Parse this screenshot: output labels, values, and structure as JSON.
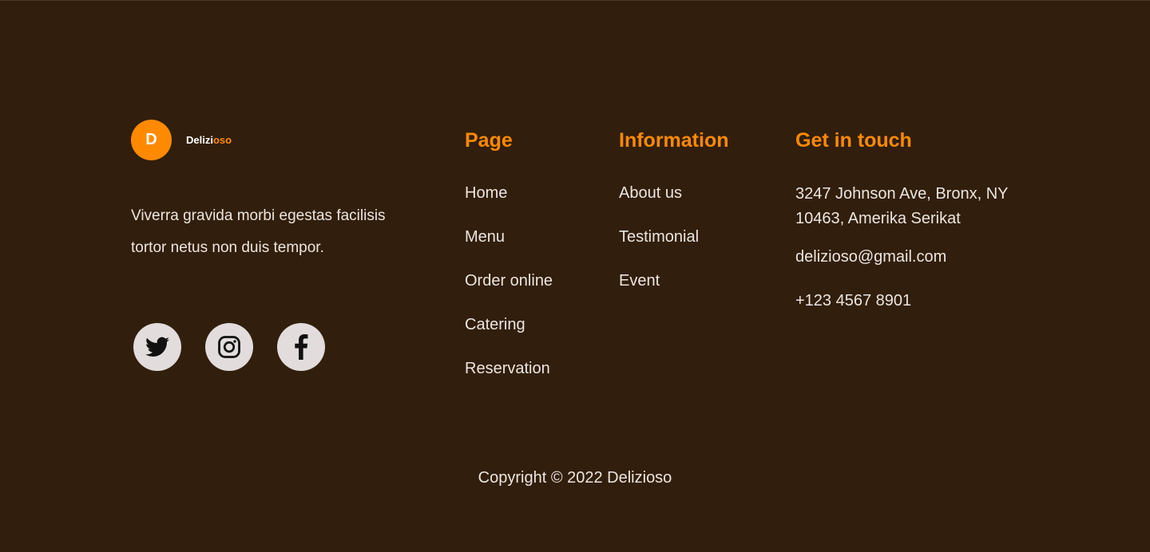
{
  "brand": {
    "logo_letter": "D",
    "name_part1": "Delizi",
    "name_part2": "oso",
    "accent_color": "#ff8a00"
  },
  "tagline": "Viverra gravida morbi egestas facilisis tortor netus non duis tempor.",
  "socials": [
    {
      "icon": "twitter-icon"
    },
    {
      "icon": "instagram-icon"
    },
    {
      "icon": "facebook-icon"
    }
  ],
  "page_column": {
    "title": "Page",
    "links": [
      "Home",
      "Menu",
      "Order online",
      "Catering",
      "Reservation"
    ]
  },
  "info_column": {
    "title": "Information",
    "links": [
      "About us",
      "Testimonial",
      "Event"
    ]
  },
  "contact_column": {
    "title": "Get in touch",
    "address": "3247 Johnson Ave, Bronx, NY 10463, Amerika Serikat",
    "email": "delizioso@gmail.com",
    "phone": "+123 4567 8901"
  },
  "copyright": "Copyright © 2022 Delizioso",
  "colors": {
    "background": "#311e0c",
    "accent": "#ff8a00",
    "text": "#ece6e0",
    "social_bg": "#e2dcdc"
  }
}
